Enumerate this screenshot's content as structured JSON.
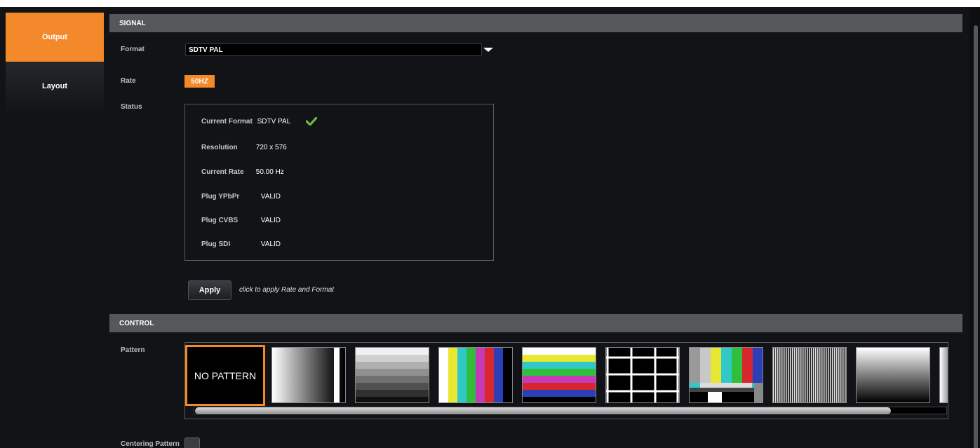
{
  "nav": {
    "items": [
      {
        "label": "Output",
        "active": true
      },
      {
        "label": "Layout",
        "active": false
      }
    ]
  },
  "signal": {
    "header": "SIGNAL",
    "format_label": "Format",
    "format_value": "SDTV PAL",
    "rate_label": "Rate",
    "rate_value": "50HZ",
    "status_label": "Status",
    "status": [
      {
        "key": "Current Format",
        "value": "SDTV PAL"
      },
      {
        "key": "Resolution",
        "value": "720 x 576"
      },
      {
        "key": "Current Rate",
        "value": "50.00 Hz"
      },
      {
        "key": "Plug YPbPr",
        "value": "VALID"
      },
      {
        "key": "Plug CVBS",
        "value": "VALID"
      },
      {
        "key": "Plug SDI",
        "value": "VALID"
      }
    ],
    "apply_label": "Apply",
    "apply_hint": "click to apply Rate and Format"
  },
  "control": {
    "header": "CONTROL",
    "pattern_label": "Pattern",
    "patterns": [
      {
        "name": "NO PATTERN",
        "icon": "no-pattern",
        "selected": true
      },
      {
        "name": "",
        "icon": "gray-ramp-vertical"
      },
      {
        "name": "",
        "icon": "gray-steps-horizontal"
      },
      {
        "name": "",
        "icon": "color-bars-vertical"
      },
      {
        "name": "",
        "icon": "color-bars-horizontal"
      },
      {
        "name": "",
        "icon": "grid"
      },
      {
        "name": "",
        "icon": "smpte-bars"
      },
      {
        "name": "",
        "icon": "multiburst"
      },
      {
        "name": "",
        "icon": "gray-gradient-vertical"
      },
      {
        "name": "",
        "icon": "gray-ramp-partial"
      }
    ],
    "centering_label": "Centering Pattern"
  },
  "colors": {
    "accent": "#f3892a",
    "background": "#111316",
    "header": "#55575a",
    "check": "#6dbb3c"
  }
}
